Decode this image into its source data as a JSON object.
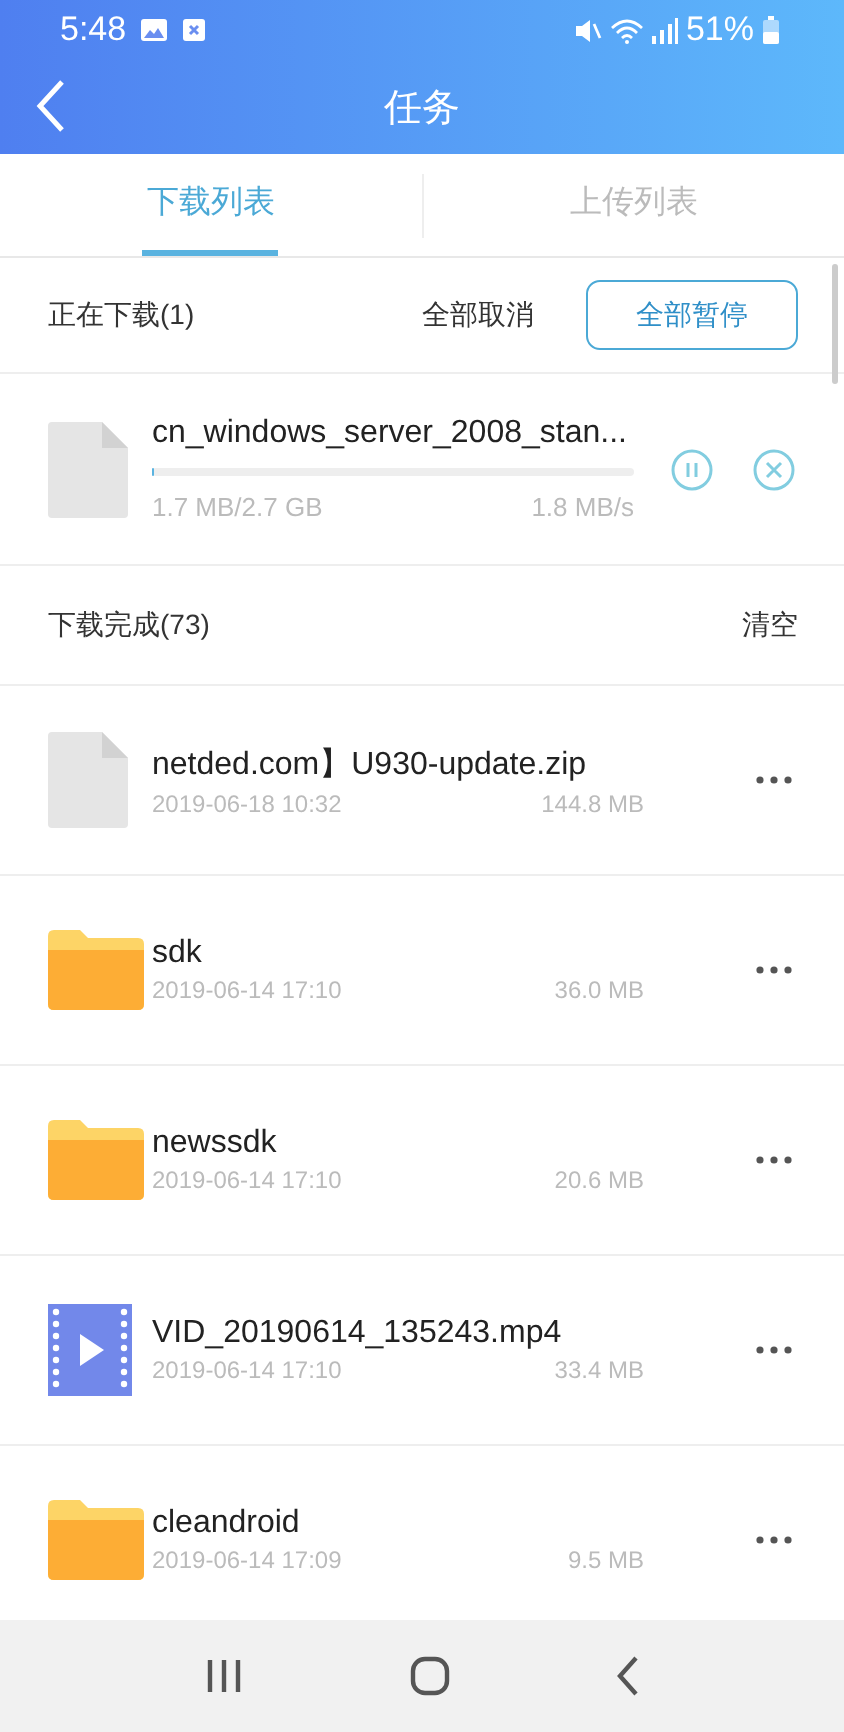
{
  "status_bar": {
    "time": "5:48",
    "battery": "51%"
  },
  "header": {
    "title": "任务"
  },
  "tabs": [
    {
      "label": "下载列表",
      "selected": true
    },
    {
      "label": "上传列表",
      "selected": false
    }
  ],
  "downloading": {
    "title": "正在下载(1)",
    "cancel_all": "全部取消",
    "pause_all": "全部暂停",
    "items": [
      {
        "name": "cn_windows_server_2008_stan...",
        "level": 0.001,
        "progress": "1.7 MB/2.7 GB",
        "speed": "1.8 MB/s"
      }
    ]
  },
  "completed": {
    "title": "下载完成(73)",
    "clear": "清空",
    "items": [
      {
        "kind": "file",
        "name": "netded.com】U930-update.zip",
        "date": "2019-06-18 10:32",
        "size": "144.8 MB"
      },
      {
        "kind": "folder",
        "name": "sdk",
        "date": "2019-06-14 17:10",
        "size": "36.0 MB"
      },
      {
        "kind": "folder",
        "name": "newssdk",
        "date": "2019-06-14 17:10",
        "size": "20.6 MB"
      },
      {
        "kind": "video",
        "name": "VID_20190614_135243.mp4",
        "date": "2019-06-14 17:10",
        "size": "33.4 MB"
      },
      {
        "kind": "folder",
        "name": "cleandroid",
        "date": "2019-06-14 17:09",
        "size": "9.5 MB"
      }
    ]
  }
}
